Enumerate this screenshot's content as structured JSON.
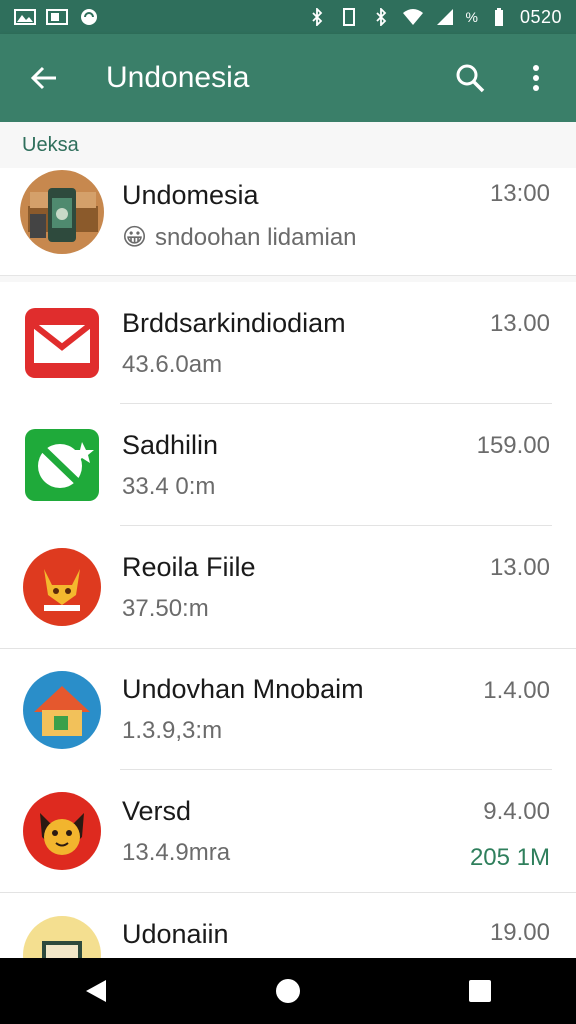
{
  "statusbar": {
    "time": "0520",
    "battery_percent": "%"
  },
  "appbar": {
    "title": "Undonesia"
  },
  "section": {
    "label": "Ueksa"
  },
  "items": [
    {
      "name": "Undomesia",
      "subtitle": "sndoohan lidamian",
      "time": "13:00",
      "emoji": "😀"
    },
    {
      "name": "Brddsarkindiodiam",
      "subtitle": "43.6.0am",
      "time": "13.00"
    },
    {
      "name": "Sadhilin",
      "subtitle": "33.4 0:m",
      "time": "159.00"
    },
    {
      "name": "Reoila Fiile",
      "subtitle": "37.50:m",
      "time": "13.00"
    },
    {
      "name": "Undovhan Mnobaim",
      "subtitle": "1.3.9,3:m",
      "time": "1.4.00"
    },
    {
      "name": "Versd",
      "subtitle": "13.4.9mra",
      "time": "9.4.00",
      "badge": "205 1M"
    },
    {
      "name": "Udonaiin",
      "subtitle": "",
      "time": "19.00"
    }
  ],
  "colors": {
    "primary": "#3a7f69",
    "status": "#2f6f5c",
    "accent_text": "#2f7f5c"
  }
}
